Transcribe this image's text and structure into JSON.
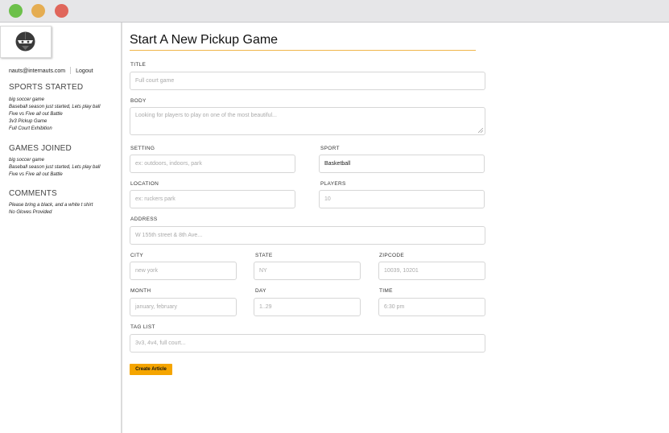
{
  "window": {
    "controls": [
      "green-dot",
      "yellow-dot",
      "red-dot"
    ]
  },
  "sidebar": {
    "user_email": "nauts@internauts.com",
    "logout_label": "Logout",
    "sports_started": {
      "title": "SPORTS STARTED",
      "items": [
        "big soccer game",
        "Baseball season just started, Lets play ball",
        "Five vs Five all out Battle",
        "3v3 Pickup Game",
        "Full Court Exhibition"
      ]
    },
    "games_joined": {
      "title": "GAMES JOINED",
      "items": [
        "big soccer game",
        "Baseball season just started, Lets play ball",
        "Five vs Five all out Battle"
      ]
    },
    "comments": {
      "title": "COMMENTS",
      "items": [
        "Please bring a black, and a white t shirt",
        "No Gloves Provided"
      ]
    }
  },
  "form": {
    "page_title": "Start A New Pickup Game",
    "title": {
      "label": "TITLE",
      "placeholder": "Full court game"
    },
    "body": {
      "label": "BODY",
      "placeholder": "Looking for players to play on one of the most beautiful..."
    },
    "setting": {
      "label": "SETTING",
      "placeholder": "ex: outdoors, indoors, park"
    },
    "sport": {
      "label": "SPORT",
      "value": "Basketball"
    },
    "location": {
      "label": "LOCATION",
      "placeholder": "ex: ruckers park"
    },
    "players": {
      "label": "PLAYERS",
      "placeholder": "10"
    },
    "address": {
      "label": "ADDRESS",
      "placeholder": "W 155th street & 8th Ave..."
    },
    "city": {
      "label": "CITY",
      "placeholder": "new york"
    },
    "state": {
      "label": "STATE",
      "placeholder": "NY"
    },
    "zipcode": {
      "label": "ZIPCODE",
      "placeholder": "10039, 10201"
    },
    "month": {
      "label": "MONTH",
      "placeholder": "january, february"
    },
    "day": {
      "label": "DAY",
      "placeholder": "1..29"
    },
    "time": {
      "label": "TIME",
      "placeholder": "6:30 pm"
    },
    "tag_list": {
      "label": "TAG LIST",
      "placeholder": "3v3, 4v4, full court..."
    },
    "submit_label": "Create Article"
  },
  "colors": {
    "accent": "#f5a500",
    "title_rule": "#f0b54a",
    "green_dot": "#6cc04a",
    "yellow_dot": "#e5ad52",
    "red_dot": "#e0665b"
  }
}
